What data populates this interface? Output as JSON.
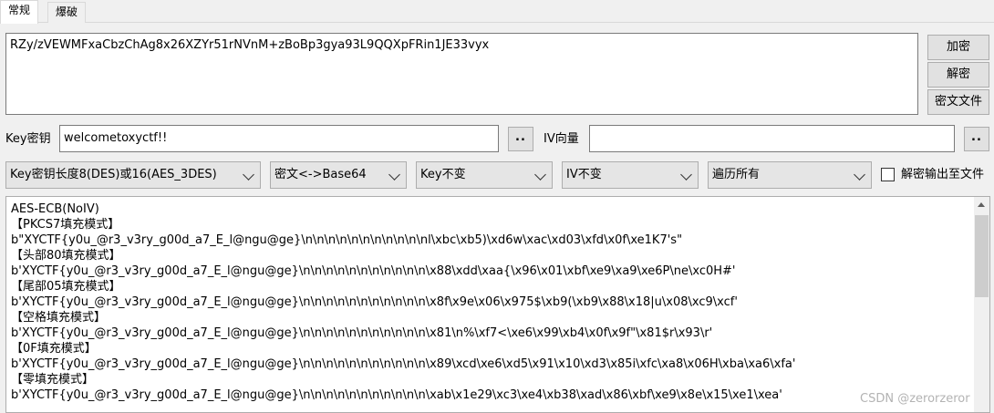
{
  "tabs": [
    {
      "label": "常规"
    },
    {
      "label": "爆破"
    }
  ],
  "input_text": "RZy/zVEWMFxaCbzChAg8x26XZYr51rNVnM+zBoBp3gya93L9QQXpFRin1JE33vyx",
  "side_buttons": {
    "encrypt": "加密",
    "decrypt": "解密",
    "cipher_file": "密文文件"
  },
  "key": {
    "label": "Key密钥",
    "value": "welcometoxyctf!!",
    "browse": ".."
  },
  "iv": {
    "label": "IV向量",
    "value": "",
    "browse": ".."
  },
  "dropdowns": {
    "key_length": "Key密钥长度8(DES)或16(AES_3DES)",
    "encoding": "密文<->Base64",
    "key_mode": "Key不变",
    "iv_mode": "IV不变",
    "traverse": "遍历所有"
  },
  "output_to_file": {
    "label": "解密输出至文件",
    "checked": false
  },
  "output_lines": [
    "AES-ECB(NoIV)",
    "【PKCS7填充模式】",
    "b\"XYCTF{y0u_@r3_v3ry_g00d_a7_E_l@ngu@ge}\\n\\n\\n\\n\\n\\n\\n\\n\\n\\n\\nl\\xbc\\xb5)\\xd6w\\xac\\xd03\\xfd\\x0f\\xe1K7's\"",
    "【头部80填充模式】",
    "b'XYCTF{y0u_@r3_v3ry_g00d_a7_E_l@ngu@ge}\\n\\n\\n\\n\\n\\n\\n\\n\\n\\n\\n\\x88\\xdd\\xaa{\\x96\\x01\\xbf\\xe9\\xa9\\xe6P\\ne\\xc0H#'",
    "【尾部05填充模式】",
    "b'XYCTF{y0u_@r3_v3ry_g00d_a7_E_l@ngu@ge}\\n\\n\\n\\n\\n\\n\\n\\n\\n\\n\\n\\x8f\\x9e\\x06\\x975$\\xb9(\\xb9\\x88\\x18|u\\x08\\xc9\\xcf'",
    "【空格填充模式】",
    "b'XYCTF{y0u_@r3_v3ry_g00d_a7_E_l@ngu@ge}\\n\\n\\n\\n\\n\\n\\n\\n\\n\\n\\n\\x81\\n%\\xf7<\\xe6\\x99\\xb4\\x0f\\x9f\"\\x81$r\\x93\\r'",
    "【0F填充模式】",
    "b'XYCTF{y0u_@r3_v3ry_g00d_a7_E_l@ngu@ge}\\n\\n\\n\\n\\n\\n\\n\\n\\n\\n\\n\\x89\\xcd\\xe6\\xd5\\x91\\x10\\xd3\\x85i\\xfc\\xa8\\x06H\\xba\\xa6\\xfa'",
    "【零填充模式】",
    "b'XYCTF{y0u_@r3_v3ry_g00d_a7_E_l@ngu@ge}\\n\\n\\n\\n\\n\\n\\n\\n\\n\\n\\n\\xab\\x1e29\\xc3\\xe4\\xb38\\xad\\x86\\xbf\\xe9\\x8e\\x15\\xe1\\xea'"
  ],
  "watermark": "CSDN @zerorzeror"
}
